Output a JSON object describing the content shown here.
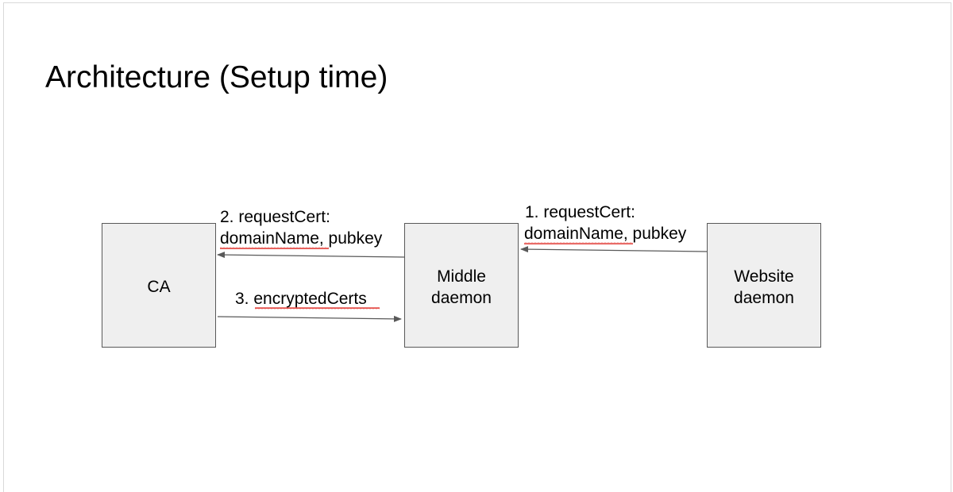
{
  "slide": {
    "title": "Architecture (Setup time)"
  },
  "nodes": {
    "ca": "CA",
    "middle": [
      "Middle",
      "daemon"
    ],
    "website": [
      "Website",
      "daemon"
    ]
  },
  "edges": {
    "step1": [
      "1. requestCert:",
      "domainName, pubkey"
    ],
    "step2": [
      "2. requestCert:",
      "domainName, pubkey"
    ],
    "step3": "3. encryptedCerts"
  },
  "colors": {
    "box_fill": "#efefef",
    "box_stroke": "#595959",
    "arrow": "#595959",
    "spellcheck_underline": "#e0302a"
  }
}
